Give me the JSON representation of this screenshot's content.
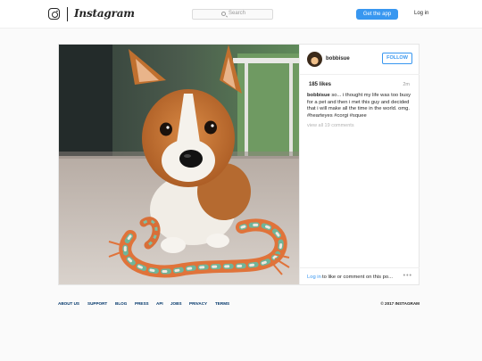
{
  "header": {
    "wordmark": "Instagram",
    "search_placeholder": "Search",
    "get_app_label": "Get the app",
    "login_label": "Log in"
  },
  "post": {
    "username": "bobbisue",
    "follow_label": "FOLLOW",
    "likes": "185 likes",
    "age": "2m",
    "caption_user": "bobbisue",
    "caption_text": "so... i thought my life was too busy for a pet and then i met this guy and decided that i will make all the time in the world. omg. #hearteyes #corgi #squee",
    "view_all": "view all 19 comments",
    "login_link": "Log in",
    "comment_prompt": "to like or comment on this po...",
    "more_icon": "more-dots-icon"
  },
  "footer": {
    "links": [
      "ABOUT US",
      "SUPPORT",
      "BLOG",
      "PRESS",
      "API",
      "JOBS",
      "PRIVACY",
      "TERMS"
    ],
    "copyright": "© 2017 INSTAGRAM"
  },
  "colors": {
    "accent": "#3897f0",
    "footer_link": "#003569",
    "background": "#fafafa"
  }
}
